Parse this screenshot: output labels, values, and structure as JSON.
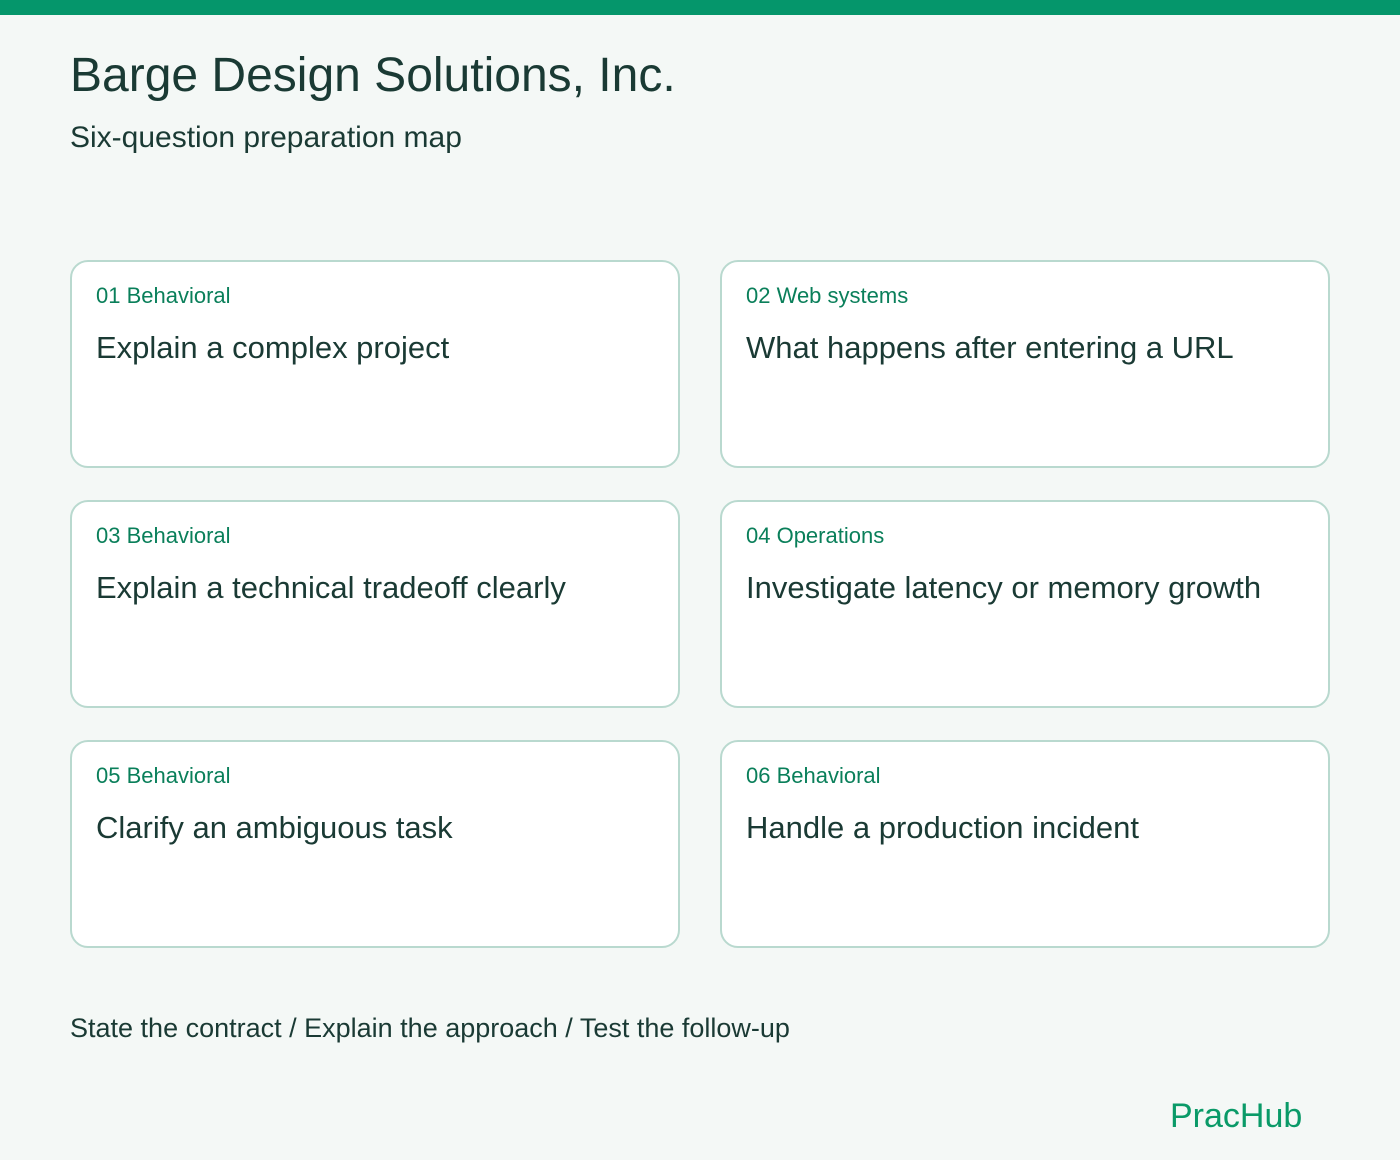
{
  "header": {
    "title": "Barge Design Solutions, Inc.",
    "subtitle": "Six-question preparation map"
  },
  "questions": [
    {
      "tag": "01 Behavioral",
      "question": "Explain a complex project"
    },
    {
      "tag": "02 Web systems",
      "question": "What happens after entering a URL"
    },
    {
      "tag": "03 Behavioral",
      "question": "Explain a technical tradeoff clearly"
    },
    {
      "tag": "04 Operations",
      "question": "Investigate latency or memory growth"
    },
    {
      "tag": "05 Behavioral",
      "question": "Clarify an ambiguous task"
    },
    {
      "tag": "06 Behavioral",
      "question": "Handle a production incident"
    }
  ],
  "footer": {
    "steps": "State the contract / Explain the approach / Test the follow-up",
    "brand": "PracHub"
  },
  "colors": {
    "accent": "#05966b",
    "tag_text": "#0a7f5a",
    "card_border": "#b9d9cf",
    "background": "#f4f8f6",
    "text": "#1a3a34"
  }
}
